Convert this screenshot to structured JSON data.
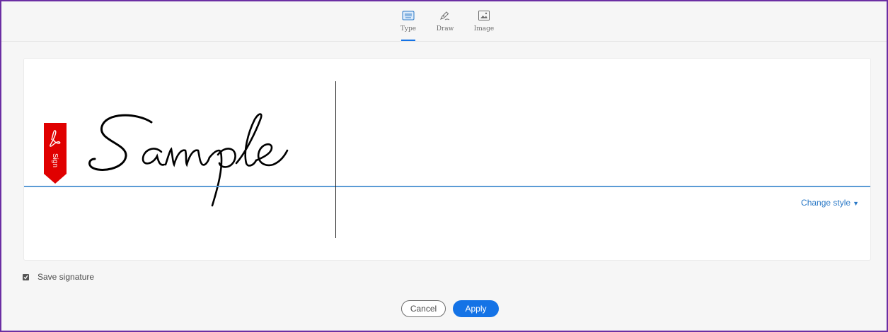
{
  "tabs": [
    {
      "label": "Type",
      "icon": "keyboard-icon",
      "active": true
    },
    {
      "label": "Draw",
      "icon": "pen-icon",
      "active": false
    },
    {
      "label": "Image",
      "icon": "image-icon",
      "active": false
    }
  ],
  "signature": {
    "text": "Sample",
    "flag_label": "Sign",
    "change_style_label": "Change style"
  },
  "save_signature": {
    "label": "Save signature",
    "checked": true
  },
  "buttons": {
    "cancel_label": "Cancel",
    "apply_label": "Apply"
  },
  "colors": {
    "accent": "#1473e6",
    "flag": "#e00000",
    "baseline": "#5b9bd5",
    "frame": "#6b2fa3"
  }
}
